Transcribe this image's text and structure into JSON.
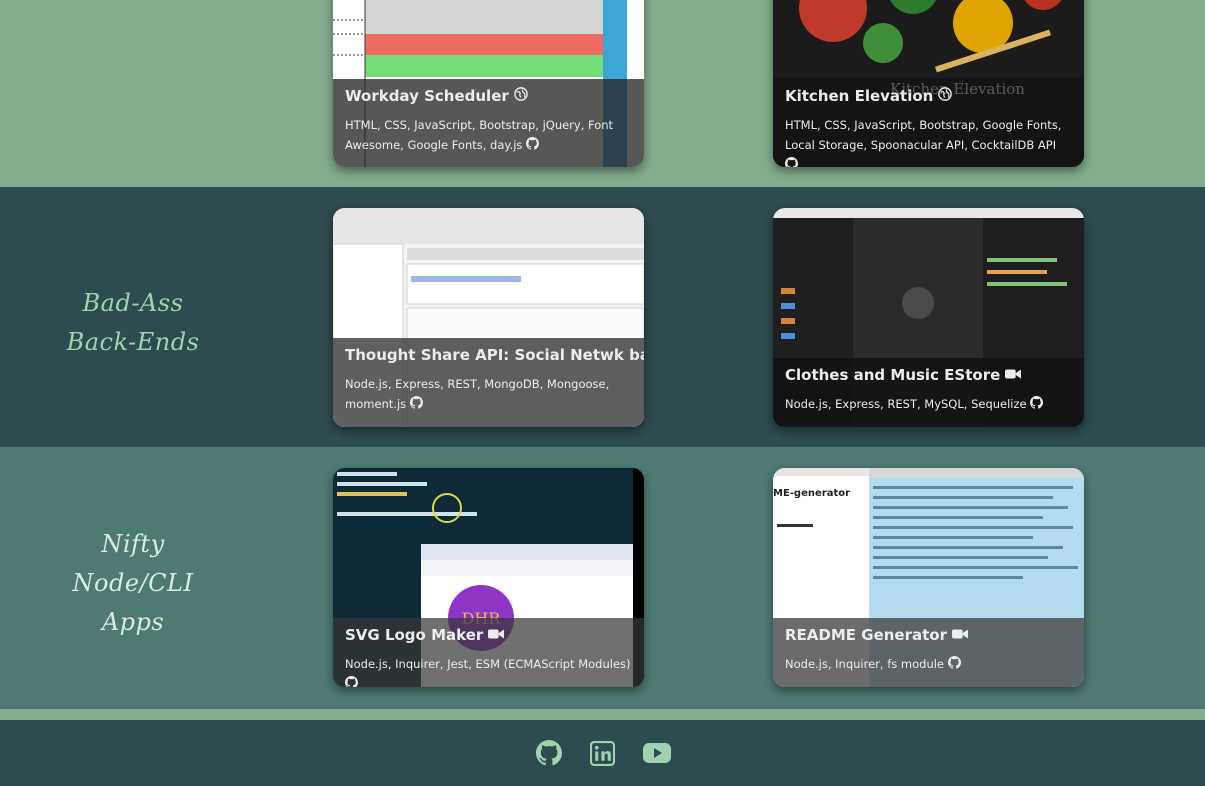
{
  "sections": [
    {
      "title_lines": []
    },
    {
      "title_lines": [
        "Bad-Ass",
        "Back-Ends"
      ]
    },
    {
      "title_lines": [
        "Nifty",
        "Node/CLI",
        "Apps"
      ]
    }
  ],
  "projects": [
    {
      "title": "Workday Scheduler",
      "link_icon": "globe-icon",
      "tech": "HTML, CSS, JavaScript, Bootstrap, jQuery, Font Awesome, Google Fonts, day.js",
      "tech_icon": "github-icon"
    },
    {
      "title": "Kitchen Elevation",
      "link_icon": "globe-icon",
      "tech": "HTML, CSS, JavaScript, Bootstrap, Google Fonts, Local Storage, Spoonacular API, CocktailDB API",
      "tech_icon": "github-icon",
      "bg_text": "Kitchen Elevation"
    },
    {
      "title": "Thought Share API: Social Netwk backend",
      "link_icon": "video-icon",
      "tech": "Node.js, Express, REST, MongoDB, Mongoose, moment.js",
      "tech_icon": "github-icon"
    },
    {
      "title": "Clothes and Music EStore",
      "link_icon": "video-icon",
      "tech": "Node.js, Express, REST, MySQL, Sequelize",
      "tech_icon": "github-icon"
    },
    {
      "title": "SVG Logo Maker",
      "link_icon": "video-icon",
      "tech": "Node.js, Inquirer, Jest, ESM (ECMAScript Modules)",
      "tech_icon": "github-icon",
      "logo_text": "DHR"
    },
    {
      "title": "README Generator",
      "link_icon": "video-icon",
      "tech": "Node.js, Inquirer, fs module",
      "tech_icon": "github-icon",
      "bg_text": "ME-generator"
    }
  ],
  "footer": {
    "icons": [
      "github-icon",
      "linkedin-icon",
      "youtube-icon"
    ]
  },
  "colors": {
    "light_band": "#84ad8e",
    "dark_band": "#2e4b4f",
    "mid_band": "#4f7a74",
    "title_green": "#9fd3b0"
  }
}
